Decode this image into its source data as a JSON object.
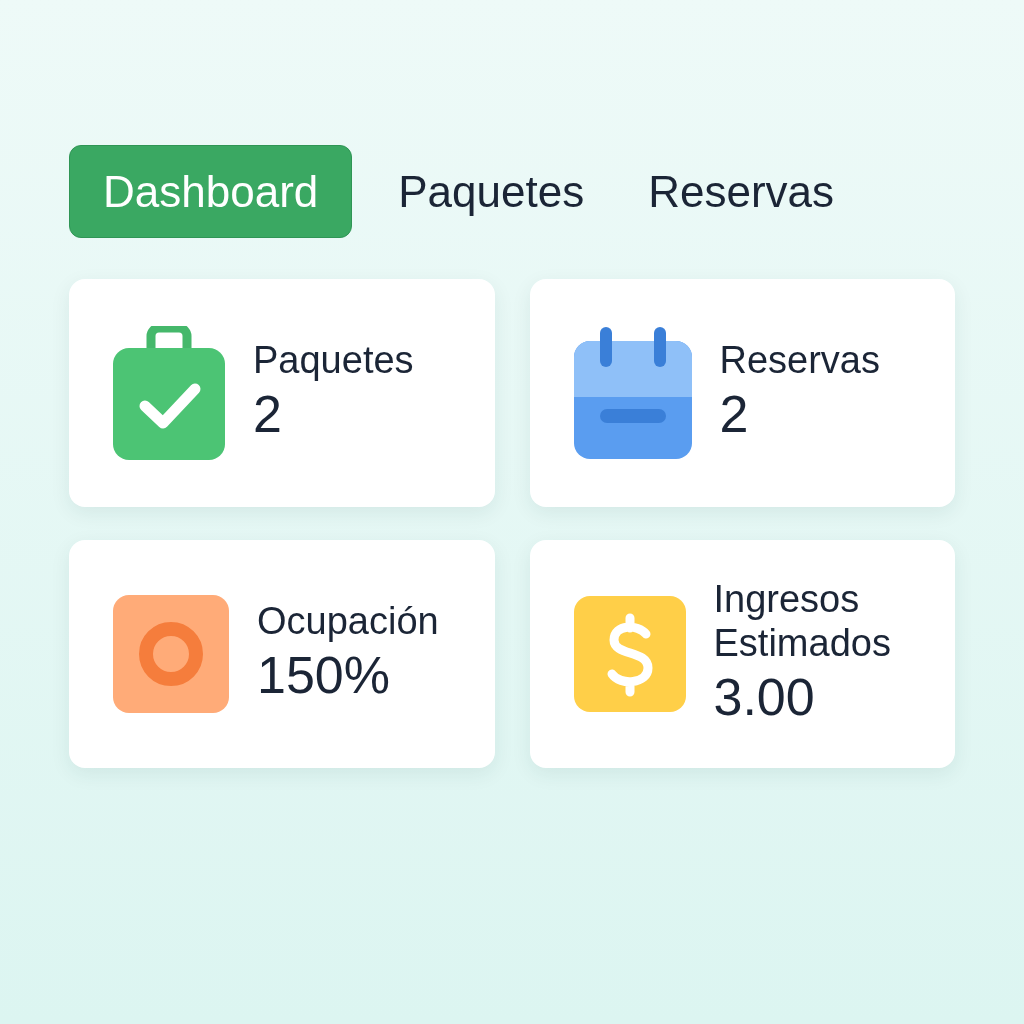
{
  "tabs": [
    {
      "label": "Dashboard",
      "selected": true
    },
    {
      "label": "Paquetes",
      "selected": false
    },
    {
      "label": "Reservas",
      "selected": false
    }
  ],
  "cards": [
    {
      "kind": "bag",
      "label": "Paquetes",
      "value": "2"
    },
    {
      "kind": "calendar",
      "label": "Reservas",
      "value": "2"
    },
    {
      "kind": "target",
      "label": "Ocupación",
      "value": "150%"
    },
    {
      "kind": "dollar",
      "label": "Ingresos Estimados",
      "value": "3.00"
    }
  ]
}
